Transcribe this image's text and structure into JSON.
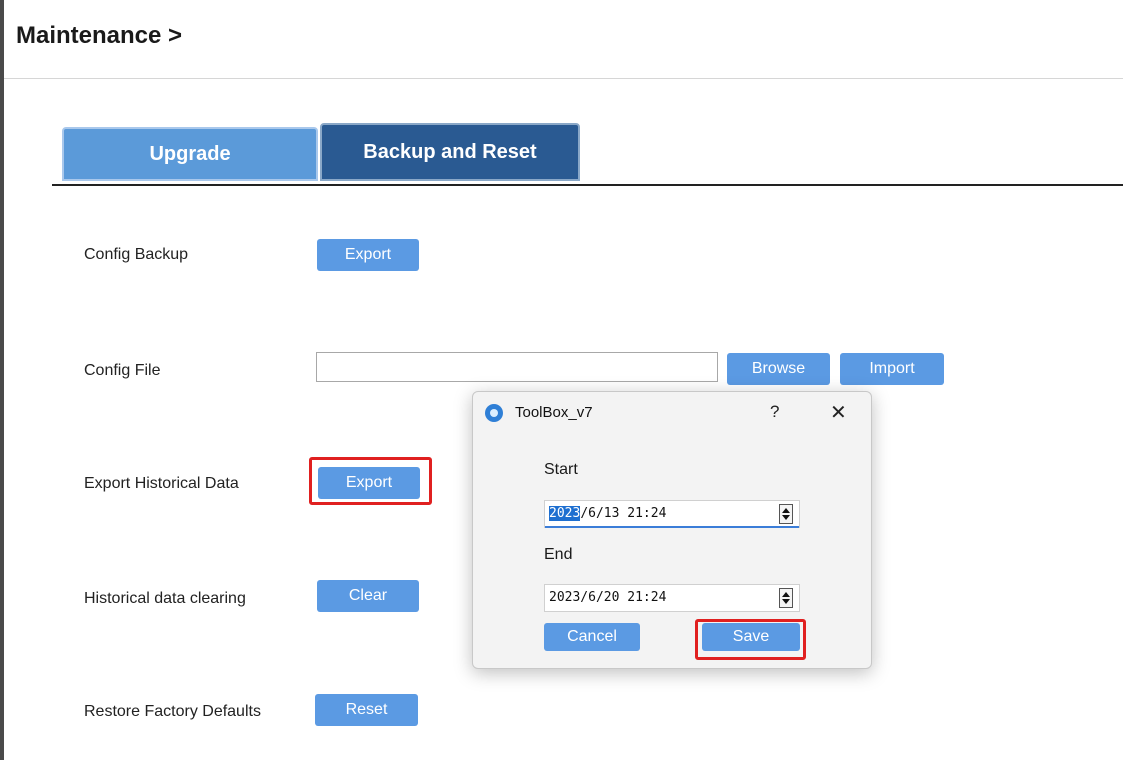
{
  "header": {
    "title": "Maintenance >"
  },
  "tabs": [
    {
      "label": "Upgrade",
      "active": false
    },
    {
      "label": "Backup and Reset",
      "active": true
    }
  ],
  "rows": {
    "config_backup": {
      "label": "Config Backup",
      "button": "Export"
    },
    "config_file": {
      "label": "Config File",
      "value": "",
      "browse": "Browse",
      "import": "Import"
    },
    "export_history": {
      "label": "Export Historical Data",
      "button": "Export"
    },
    "history_clear": {
      "label": "Historical data clearing",
      "button": "Clear"
    },
    "factory_reset": {
      "label": "Restore Factory Defaults",
      "button": "Reset"
    }
  },
  "dialog": {
    "title": "ToolBox_v7",
    "help": "?",
    "close": "✕",
    "start_label": "Start",
    "start_selected": "2023",
    "start_rest": "/6/13 21:24",
    "end_label": "End",
    "end_value": "2023/6/20 21:24",
    "cancel": "Cancel",
    "save": "Save"
  },
  "colors": {
    "button_blue": "#5b9ae3",
    "tab_active": "#2a5a92",
    "tab_inactive": "#5b9ad9",
    "highlight_red": "#e02020"
  }
}
